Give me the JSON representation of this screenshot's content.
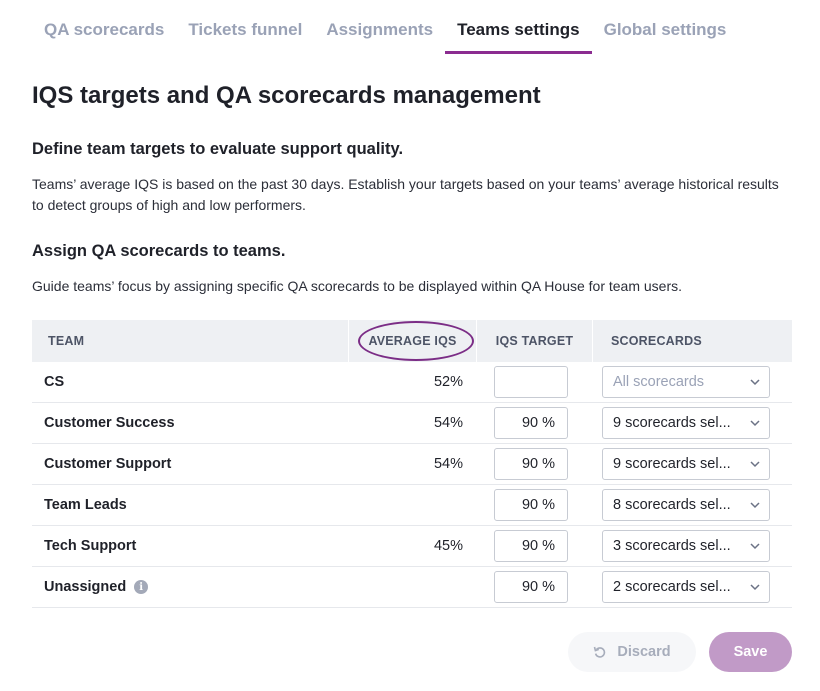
{
  "tabs": [
    {
      "label": "QA scorecards",
      "active": false
    },
    {
      "label": "Tickets funnel",
      "active": false
    },
    {
      "label": "Assignments",
      "active": false
    },
    {
      "label": "Teams settings",
      "active": true
    },
    {
      "label": "Global settings",
      "active": false
    }
  ],
  "page": {
    "title": "IQS targets and QA scorecards management",
    "section1_heading": "Define team targets to evaluate support quality.",
    "section1_text": "Teams’ average IQS is based on the past 30 days. Establish your targets based on your teams’ average historical results to detect groups of high and low performers.",
    "section2_heading": "Assign QA scorecards to teams.",
    "section2_text": "Guide teams’ focus by assigning specific QA scorecards to be displayed within QA House for team users."
  },
  "table": {
    "headers": {
      "team": "TEAM",
      "avg": "AVERAGE IQS",
      "target": "IQS TARGET",
      "scorecards": "SCORECARDS"
    },
    "rows": [
      {
        "team": "CS",
        "avg": "52%",
        "target": "",
        "scorecards": "All scorecards"
      },
      {
        "team": "Customer Success",
        "avg": "54%",
        "target": "90 %",
        "scorecards": "9 scorecards sel..."
      },
      {
        "team": "Customer Support",
        "avg": "54%",
        "target": "90 %",
        "scorecards": "9 scorecards sel..."
      },
      {
        "team": "Team Leads",
        "avg": "",
        "target": "90 %",
        "scorecards": "8 scorecards sel..."
      },
      {
        "team": "Tech Support",
        "avg": "45%",
        "target": "90 %",
        "scorecards": "3 scorecards sel..."
      },
      {
        "team": "Unassigned",
        "avg": "",
        "target": "90 %",
        "scorecards": "2 scorecards sel..."
      }
    ],
    "info_glyph": "i"
  },
  "actions": {
    "discard": "Discard",
    "save": "Save"
  },
  "colors": {
    "accent": "#8b2c90",
    "save_bg": "#c19ac7",
    "muted": "#9aa2b6"
  }
}
